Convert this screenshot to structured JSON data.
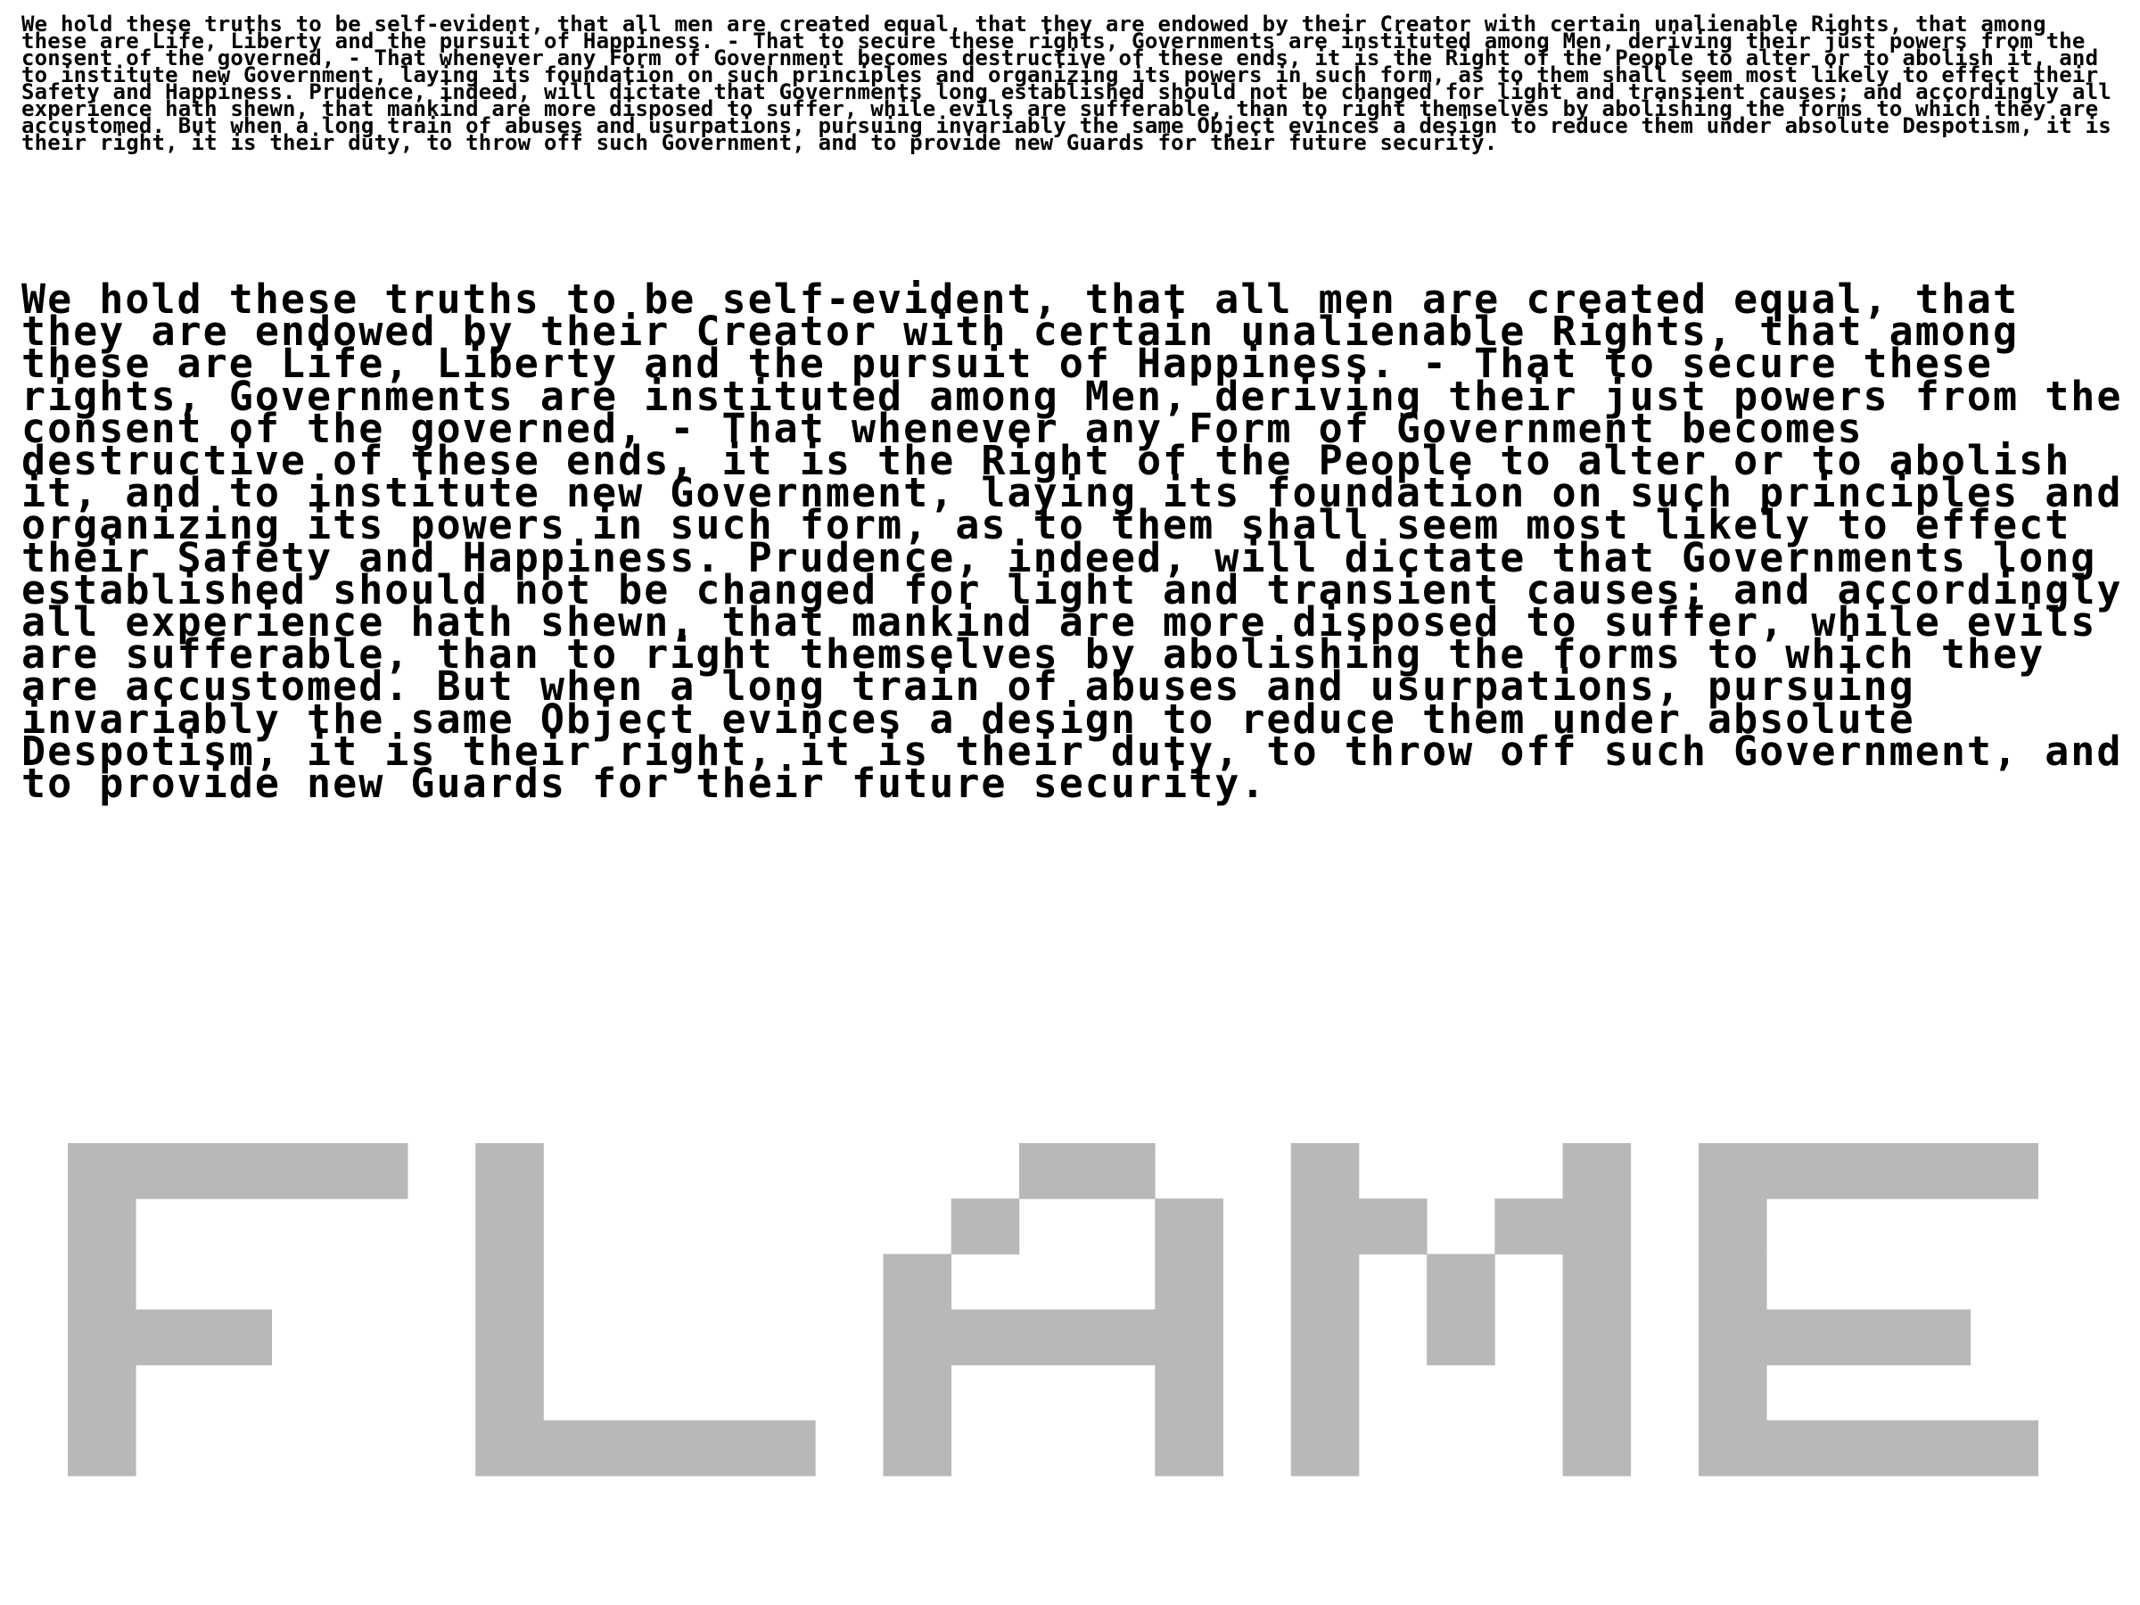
{
  "specimen": {
    "paragraph_small": "We hold these truths to be self-evident, that all men are created equal, that they are endowed by their Creator with certain unalienable Rights, that among these are Life, Liberty and the pursuit of Happiness. - That to secure these rights, Governments are instituted among Men, deriving their just powers from the consent of the governed, - That whenever any Form of Government becomes destructive of these ends, it is the Right of the People to alter or to abolish it, and to institute new Government, laying its foundation on such principles and organizing its powers in such form, as to them shall seem most likely to effect their Safety and Happiness. Prudence, indeed, will dictate that Governments long established should not be changed for light and transient causes; and accordingly all experience hath shewn, that mankind are more disposed to suffer, while evils are sufferable, than to right themselves by abolishing the forms to which they are accustomed. But when a long train of abuses and usurpations, pursuing invariably the same Object evinces a design to reduce them under absolute Despotism, it is their right, it is their duty, to throw off such Government, and to provide new Guards for their future security.",
    "paragraph_large": "We hold these truths to be self-evident, that all men are created equal, that they are endowed by their Creator with certain unalienable Rights, that among these are Life, Liberty and the pursuit of Happiness. - That to secure these rights, Governments are instituted among Men, deriving their just powers from the consent of the governed, - That whenever any Form of Government becomes destructive of these ends, it is the Right of the People to alter or to abolish it, and to institute new Government, laying its foundation on such principles and organizing its powers in such form, as to them shall seem most likely to effect their Safety and Happiness. Prudence, indeed, will dictate that Governments long established should not be changed for light and transient causes; and accordingly all experience hath shewn, that mankind are more disposed to suffer, while evils are sufferable, than to right themselves by abolishing the forms to which they are accustomed. But when a long train of abuses and usurpations, pursuing invariably the same Object evinces a design to reduce them under absolute Despotism, it is their right, it is their duty, to throw off such Government, and to provide new Guards for their future security.",
    "display_word": "FLAME",
    "display_color": "#b8b8b8",
    "text_color": "#000000",
    "background_color": "#ffffff"
  }
}
